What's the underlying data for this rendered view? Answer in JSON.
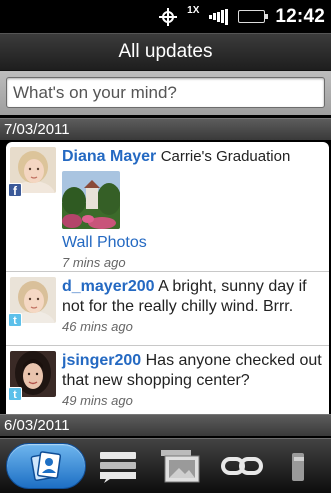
{
  "status_bar": {
    "time": "12:42",
    "data_indicator": "1X",
    "icons": [
      "gps-icon",
      "data-arrows-icon",
      "signal-icon",
      "battery-icon"
    ]
  },
  "header": {
    "title": "All updates"
  },
  "compose": {
    "placeholder": "What's on your mind?"
  },
  "date_groups": [
    {
      "date": "7/03/2011"
    },
    {
      "date": "6/03/2011"
    }
  ],
  "feed": [
    {
      "author": "Diana Mayer",
      "text": "Carrie's Graduation",
      "source": "facebook",
      "album": "Wall Photos",
      "time": "7 mins ago"
    },
    {
      "author": "d_mayer200",
      "text": "A bright, sunny day if not for the really chilly wind. Brrr.",
      "source": "twitter",
      "time": "46 mins ago"
    },
    {
      "author": "jsinger200",
      "text": "Has anyone checked out that new shopping center?",
      "source": "twitter",
      "time": "49 mins ago"
    }
  ],
  "tabs": [
    {
      "icon": "people-updates-icon",
      "active": true
    },
    {
      "icon": "messages-icon",
      "active": false
    },
    {
      "icon": "photos-icon",
      "active": false
    },
    {
      "icon": "links-icon",
      "active": false
    },
    {
      "icon": "more-icon",
      "active": false
    }
  ],
  "colors": {
    "accent_blue": "#2469c2",
    "active_tab": "#1d6fc4",
    "facebook": "#3b5998",
    "twitter": "#5cc0ea"
  }
}
